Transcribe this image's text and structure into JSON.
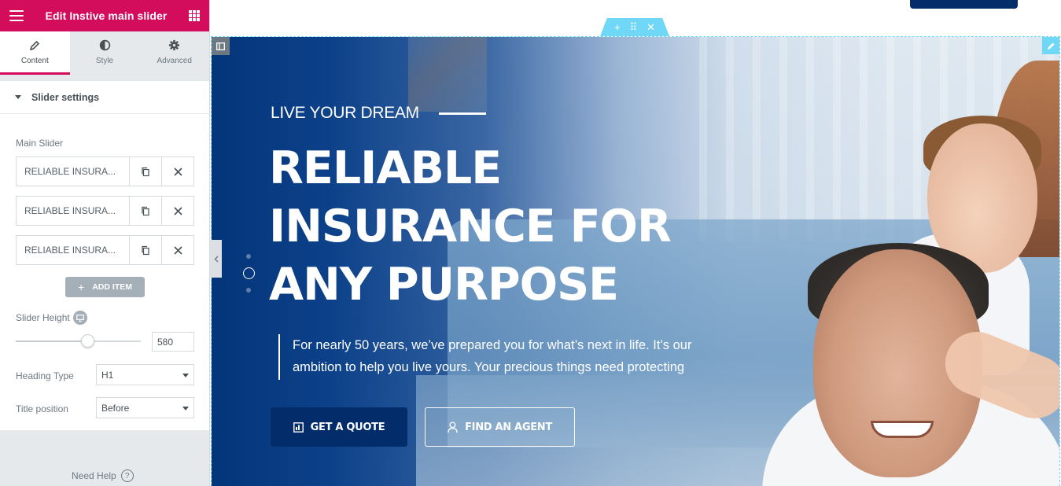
{
  "panel": {
    "title": "Edit Instive main slider",
    "tabs": [
      {
        "label": "Content",
        "icon": "pencil-icon",
        "active": true
      },
      {
        "label": "Style",
        "icon": "contrast-icon",
        "active": false
      },
      {
        "label": "Advanced",
        "icon": "gear-icon",
        "active": false
      }
    ],
    "section_title": "Slider settings",
    "main_slider_label": "Main Slider",
    "items": [
      {
        "title": "RELIABLE INSURA..."
      },
      {
        "title": "RELIABLE INSURA..."
      },
      {
        "title": "RELIABLE INSURA..."
      }
    ],
    "add_item_label": "ADD ITEM",
    "slider_height_label": "Slider Height",
    "slider_height_value": "580",
    "heading_type_label": "Heading Type",
    "heading_type_value": "H1",
    "title_position_label": "Title position",
    "title_position_value": "Before",
    "need_help_label": "Need Help",
    "need_help_icon": "?"
  },
  "canvas": {
    "section_handle": {
      "add": "+",
      "move": "⠿",
      "close": "✕"
    }
  },
  "hero": {
    "eyebrow": "LIVE YOUR DREAM",
    "title_line1": "RELIABLE",
    "title_line2": "INSURANCE FOR",
    "title_line3": "ANY PURPOSE",
    "description_line1": "For nearly 50 years, we’ve prepared you for what’s next in life. It’s our",
    "description_line2": "ambition to help you live yours. Your precious things need protecting",
    "btn_quote": "GET A QUOTE",
    "btn_agent": "FIND AN AGENT",
    "active_slide": 2,
    "slide_count": 3
  },
  "colors": {
    "panel_accent": "#d30c5c",
    "hero_navy": "#032c6b",
    "editor_handle": "#71d7f7"
  }
}
